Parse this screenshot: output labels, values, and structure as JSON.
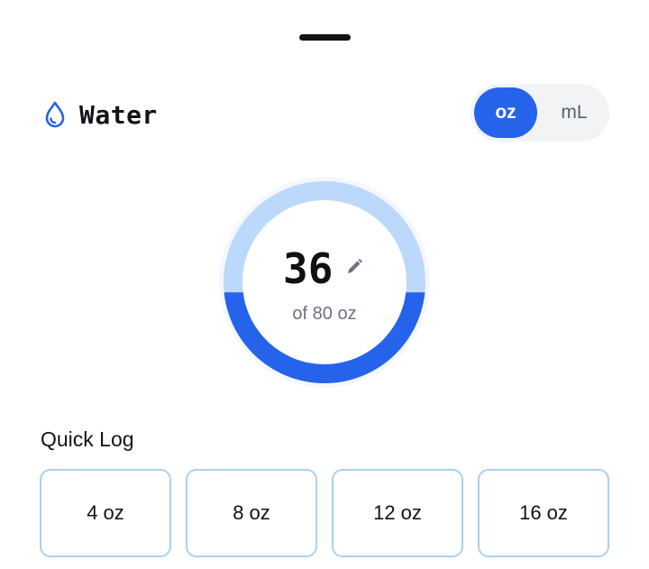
{
  "header": {
    "title": "Water",
    "icon": "water-drop-icon"
  },
  "unit_toggle": {
    "options": [
      "oz",
      "mL"
    ],
    "selected": "oz"
  },
  "gauge": {
    "current": "36",
    "goal_text": "of 80 oz",
    "fill_fraction": 0.45,
    "edit_icon": "pencil-icon"
  },
  "quick_log": {
    "title": "Quick Log",
    "amounts": [
      "4 oz",
      "8 oz",
      "12 oz",
      "16 oz"
    ]
  },
  "colors": {
    "accent": "#2563eb",
    "ring_track": "#bcd8fb",
    "quick_border": "#a9d1f3"
  }
}
